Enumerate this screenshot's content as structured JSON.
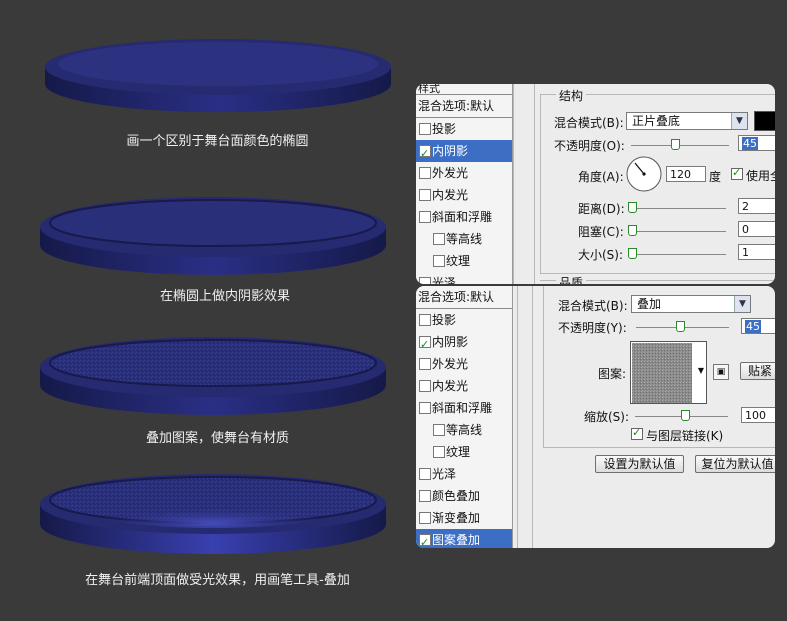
{
  "captions": [
    "画一个区别于舞台面颜色的椭圆",
    "在椭圆上做内阴影效果",
    "叠加图案，使舞台有材质",
    "在舞台前端顶面做受光效果，用画笔工具-叠加"
  ],
  "panel1": {
    "tab_partial": "样式",
    "blend_options": "混合选项:默认",
    "styles": [
      {
        "label": "投影",
        "checked": false,
        "sub": false,
        "selected": false
      },
      {
        "label": "内阴影",
        "checked": true,
        "sub": false,
        "selected": true
      },
      {
        "label": "外发光",
        "checked": false,
        "sub": false,
        "selected": false
      },
      {
        "label": "内发光",
        "checked": false,
        "sub": false,
        "selected": false
      },
      {
        "label": "斜面和浮雕",
        "checked": false,
        "sub": false,
        "selected": false
      },
      {
        "label": "等高线",
        "checked": false,
        "sub": true,
        "selected": false
      },
      {
        "label": "纹理",
        "checked": false,
        "sub": true,
        "selected": false
      },
      {
        "label": "光泽",
        "checked": false,
        "sub": false,
        "selected": false
      }
    ],
    "group_title": "结构",
    "blend_mode_label": "混合模式(B):",
    "blend_mode_value": "正片叠底",
    "opacity_label": "不透明度(O):",
    "opacity_value": "45",
    "angle_label": "角度(A):",
    "angle_value": "120",
    "angle_unit": "度",
    "use_global_label": "使用全",
    "distance_label": "距离(D):",
    "distance_value": "2",
    "choke_label": "阻塞(C):",
    "choke_value": "0",
    "size_label": "大小(S):",
    "size_value": "1",
    "quality_partial": "品质",
    "color_swatch": "#000000"
  },
  "panel2": {
    "blend_options": "混合选项:默认",
    "styles": [
      {
        "label": "投影",
        "checked": false,
        "sub": false,
        "selected": false
      },
      {
        "label": "内阴影",
        "checked": true,
        "sub": false,
        "selected": false
      },
      {
        "label": "外发光",
        "checked": false,
        "sub": false,
        "selected": false
      },
      {
        "label": "内发光",
        "checked": false,
        "sub": false,
        "selected": false
      },
      {
        "label": "斜面和浮雕",
        "checked": false,
        "sub": false,
        "selected": false
      },
      {
        "label": "等高线",
        "checked": false,
        "sub": true,
        "selected": false
      },
      {
        "label": "纹理",
        "checked": false,
        "sub": true,
        "selected": false
      },
      {
        "label": "光泽",
        "checked": false,
        "sub": false,
        "selected": false
      },
      {
        "label": "颜色叠加",
        "checked": false,
        "sub": false,
        "selected": false
      },
      {
        "label": "渐变叠加",
        "checked": false,
        "sub": false,
        "selected": false
      },
      {
        "label": "图案叠加",
        "checked": true,
        "sub": false,
        "selected": true
      }
    ],
    "blend_mode_label": "混合模式(B):",
    "blend_mode_value": "叠加",
    "opacity_label": "不透明度(Y):",
    "opacity_value": "45",
    "pattern_label": "图案:",
    "snap_button": "贴紧",
    "scale_label": "缩放(S):",
    "scale_value": "100",
    "link_label": "与图层链接(K)",
    "set_default_button": "设置为默认值",
    "reset_default_button": "复位为默认值"
  },
  "colors": {
    "background": "#3a3a3a",
    "stage_dark": "#1a1e5c",
    "stage_top": "#2a2f7a",
    "selection": "#3c6fc4"
  }
}
